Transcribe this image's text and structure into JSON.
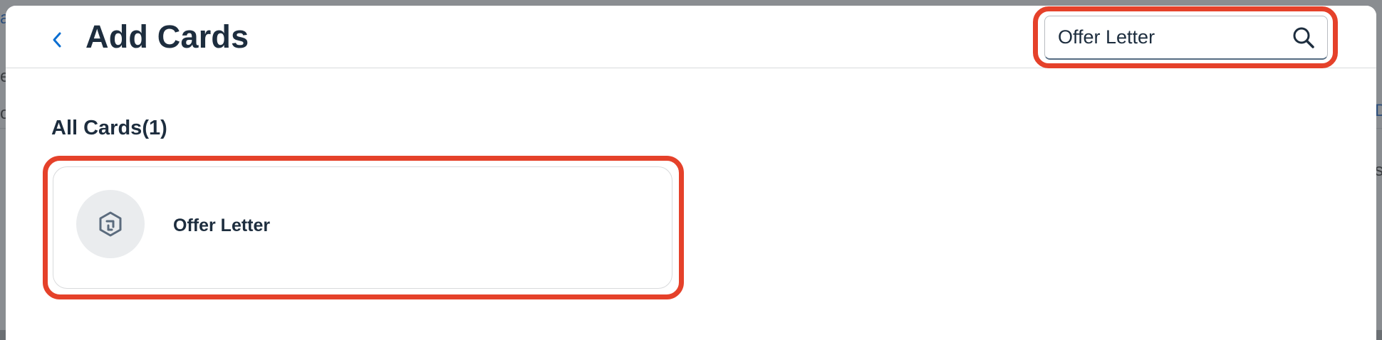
{
  "dialog": {
    "title": "Add Cards",
    "back_icon": "chevron-left-icon"
  },
  "search": {
    "value": "Offer Letter",
    "icon": "search-icon"
  },
  "section": {
    "title": "All Cards(1)"
  },
  "cards": [
    {
      "title": "Offer Letter",
      "icon": "hexagon-card-icon"
    }
  ],
  "colors": {
    "accent": "#0a6ed1",
    "highlight": "#e5412a",
    "text": "#1d2d3e"
  }
}
